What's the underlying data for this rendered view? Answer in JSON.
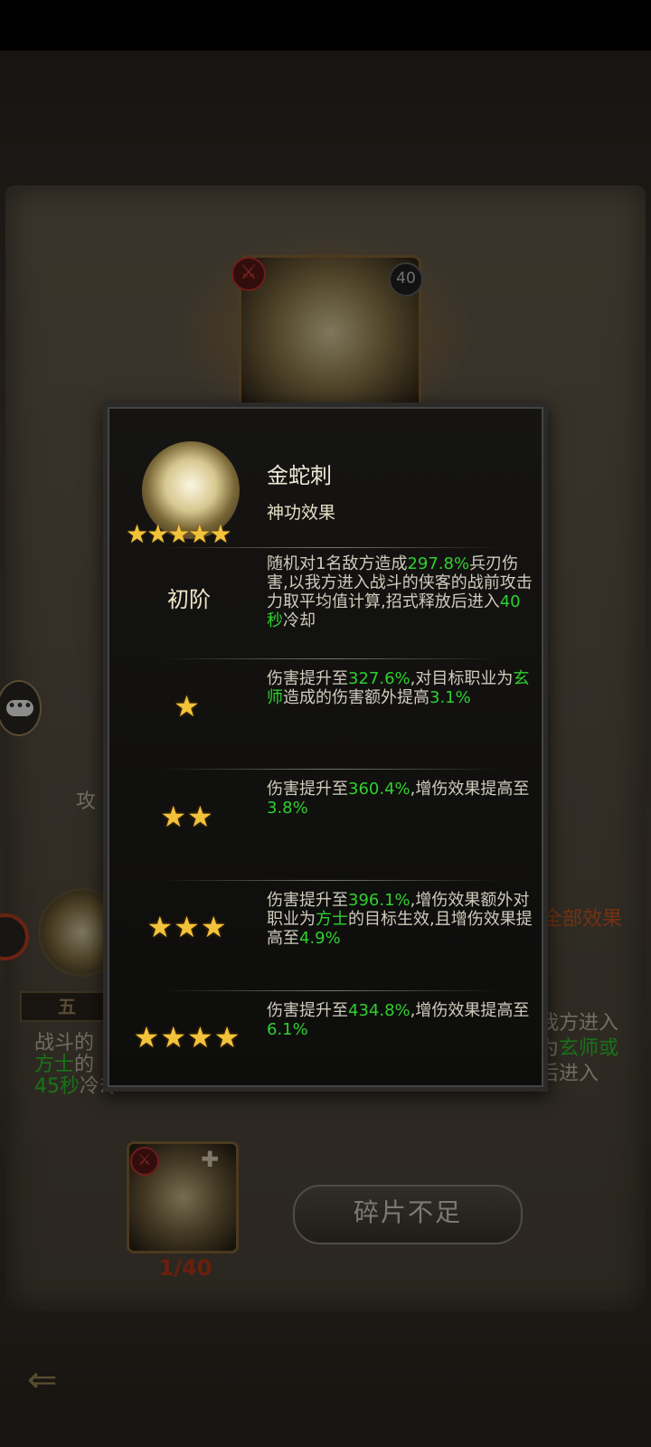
{
  "card": {
    "badge_icon": "swords",
    "level": "40"
  },
  "background": {
    "attack_fragment": "攻",
    "right_link": "全部效果",
    "rank_plate": "五",
    "desc_left_lines": [
      "战斗的",
      "方士的"
    ],
    "desc_left_green": "方士",
    "cooldown_green": "45秒",
    "cooldown_text": "冷却",
    "desc_right_lines": [
      "我方进入",
      "为",
      "后进入"
    ],
    "desc_right_green": "玄师或"
  },
  "fragment": {
    "count": "1/40"
  },
  "buttons": {
    "insufficient": "碎片不足"
  },
  "modal": {
    "skill_name": "金蛇刺",
    "skill_type": "神功效果",
    "portrait_stars": "★★★★★",
    "tiers": [
      {
        "label": "初阶",
        "stars": "",
        "segments": [
          {
            "t": "随机对1名敌方造成",
            "g": false
          },
          {
            "t": "297.8%",
            "g": true
          },
          {
            "t": "兵刃伤害,以我方进入战斗的侠客的战前攻击力取平均值计算,招式释放后进入",
            "g": false
          },
          {
            "t": "40秒",
            "g": true
          },
          {
            "t": "冷却",
            "g": false
          }
        ]
      },
      {
        "label": "",
        "stars": "★",
        "segments": [
          {
            "t": "伤害提升至",
            "g": false
          },
          {
            "t": "327.6%",
            "g": true
          },
          {
            "t": ",对目标职业为",
            "g": false
          },
          {
            "t": "玄师",
            "g": true
          },
          {
            "t": "造成的伤害额外提高",
            "g": false
          },
          {
            "t": "3.1%",
            "g": true
          }
        ]
      },
      {
        "label": "",
        "stars": "★★",
        "segments": [
          {
            "t": "伤害提升至",
            "g": false
          },
          {
            "t": "360.4%",
            "g": true
          },
          {
            "t": ",增伤效果提高至",
            "g": false
          },
          {
            "t": "3.8%",
            "g": true
          }
        ]
      },
      {
        "label": "",
        "stars": "★★★",
        "segments": [
          {
            "t": "伤害提升至",
            "g": false
          },
          {
            "t": "396.1%",
            "g": true
          },
          {
            "t": ",增伤效果额外对职业为",
            "g": false
          },
          {
            "t": "方士",
            "g": true
          },
          {
            "t": "的目标生效,且增伤效果提高至",
            "g": false
          },
          {
            "t": "4.9%",
            "g": true
          }
        ]
      },
      {
        "label": "",
        "stars": "★★★★",
        "segments": [
          {
            "t": "伤害提升至",
            "g": false
          },
          {
            "t": "434.8%",
            "g": true
          },
          {
            "t": ",增伤效果提高至",
            "g": false
          },
          {
            "t": "6.1%",
            "g": true
          }
        ]
      }
    ]
  },
  "colors": {
    "highlight": "#2ed02e",
    "star": "#f2c33a",
    "warning": "#c43a1a"
  }
}
